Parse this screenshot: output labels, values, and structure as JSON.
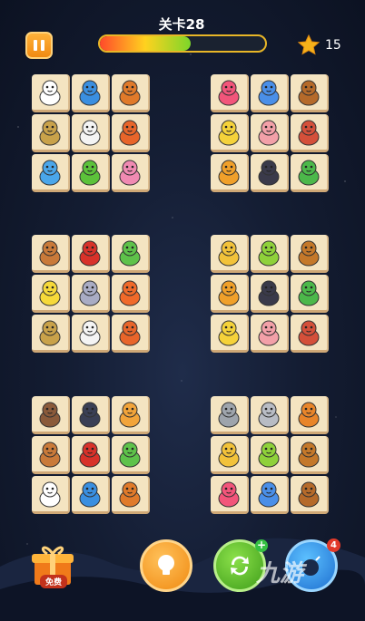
{
  "header": {
    "level_label": "关卡28",
    "progress_fraction": 0.55,
    "star_count": "15"
  },
  "groups": [
    {
      "id": "g1",
      "tiles": [
        "polar-bear",
        "shark",
        "ladybug",
        "owl",
        "seal",
        "squirrel",
        "fish",
        "dinosaur",
        "snail"
      ]
    },
    {
      "id": "g2",
      "tiles": [
        "octopus",
        "rhino",
        "ant",
        "bee",
        "pig",
        "hedgehog",
        "lion",
        "toucan",
        "snake"
      ]
    },
    {
      "id": "g3",
      "tiles": [
        "horse",
        "gorilla",
        "frog",
        "duck",
        "mouse",
        "fox",
        "owl",
        "seal",
        "squirrel"
      ]
    },
    {
      "id": "g4",
      "tiles": [
        "cheetah",
        "parrot",
        "bull",
        "lion",
        "toucan",
        "snake",
        "bee",
        "pig",
        "hedgehog"
      ]
    },
    {
      "id": "g5",
      "tiles": [
        "bear",
        "penguin",
        "tiger",
        "horse",
        "gorilla",
        "frog",
        "polar-bear",
        "shark",
        "ladybug"
      ]
    },
    {
      "id": "g6",
      "tiles": [
        "hippo",
        "elephant",
        "dog",
        "cheetah",
        "parrot",
        "bull",
        "octopus",
        "rhino",
        "ant"
      ]
    }
  ],
  "footer": {
    "gift_label": "免费",
    "bomb_badge": "4",
    "refresh_plus": "+",
    "watermark": "九游"
  },
  "animal_colors": {
    "polar-bear": "#ffffff",
    "shark": "#3a8fe0",
    "ladybug": "#e07a2a",
    "owl": "#c9a24a",
    "seal": "#f4f4f4",
    "squirrel": "#e8652a",
    "fish": "#4aa6ea",
    "dinosaur": "#5cc23a",
    "snail": "#f08ab2",
    "octopus": "#f2557a",
    "rhino": "#4a8fe8",
    "ant": "#b56a2a",
    "bee": "#f5d23a",
    "pig": "#f2a0a8",
    "hedgehog": "#d4503a",
    "lion": "#f0a02a",
    "toucan": "#3a3a4a",
    "snake": "#4cb84a",
    "horse": "#c97a3a",
    "gorilla": "#d8322a",
    "frog": "#5ec24a",
    "duck": "#f6d93a",
    "mouse": "#a9acc4",
    "fox": "#f06a2a",
    "cheetah": "#f2c23a",
    "parrot": "#8fd13a",
    "bull": "#c4782a",
    "bear": "#8a5a3a",
    "penguin": "#3a3f55",
    "tiger": "#f2a43a",
    "hippo": "#9ea4ac",
    "elephant": "#b8bcc4",
    "dog": "#e8852a"
  }
}
